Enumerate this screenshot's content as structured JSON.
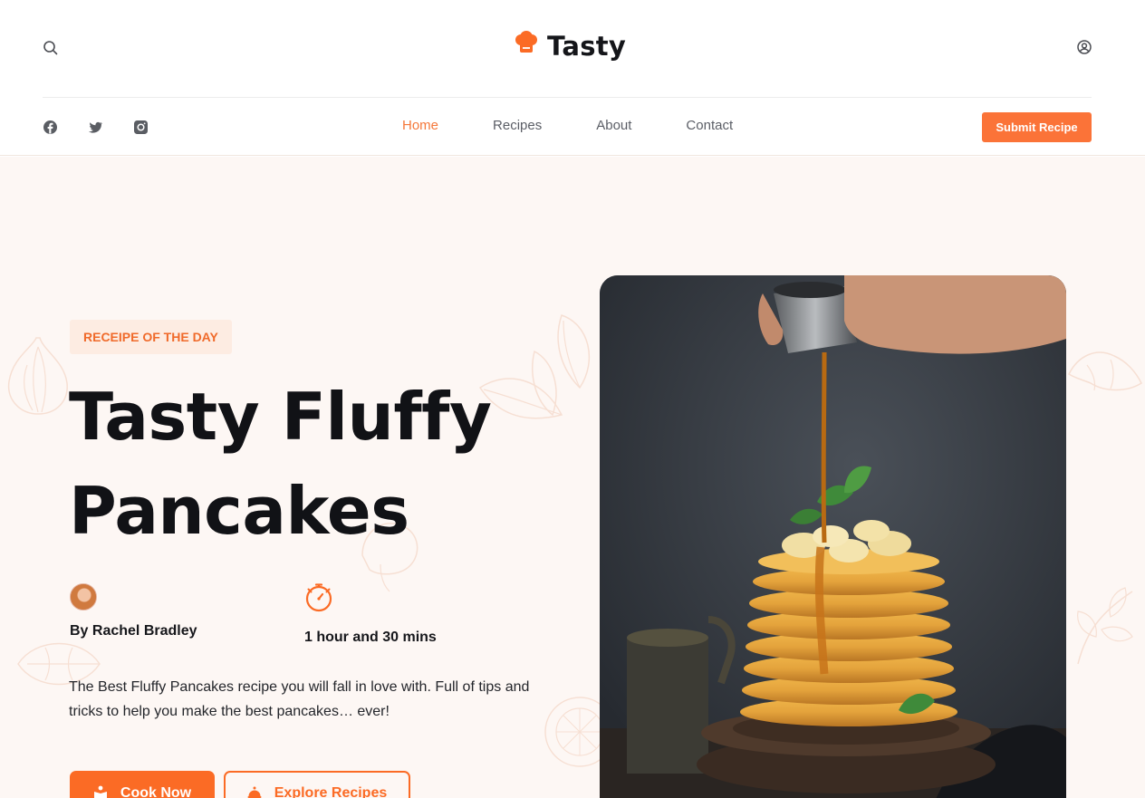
{
  "header": {
    "brand": "Tasty",
    "colors": {
      "accent": "#fb7338",
      "text": "#111216",
      "muted": "#5b5e66",
      "hero_bg": "#fdf7f4",
      "badge_bg": "#fdece2"
    }
  },
  "nav": {
    "links": [
      {
        "label": "Home",
        "active": true
      },
      {
        "label": "Recipes",
        "active": false
      },
      {
        "label": "About",
        "active": false
      },
      {
        "label": "Contact",
        "active": false
      }
    ],
    "submit_label": "Submit Recipe",
    "social_icons": [
      "facebook-icon",
      "twitter-icon",
      "instagram-icon"
    ]
  },
  "hero": {
    "badge": "RECEIPE OF THE DAY",
    "title_line1": "Tasty Fluffy",
    "title_line2": "Pancakes",
    "author": "By Rachel Bradley",
    "duration": "1 hour and 30 mins",
    "description": "The Best Fluffy Pancakes recipe you will fall in love with. Full of tips and tricks to help you make the best pancakes… ever!",
    "cook_label": "Cook Now",
    "explore_label": "Explore Recipes"
  }
}
